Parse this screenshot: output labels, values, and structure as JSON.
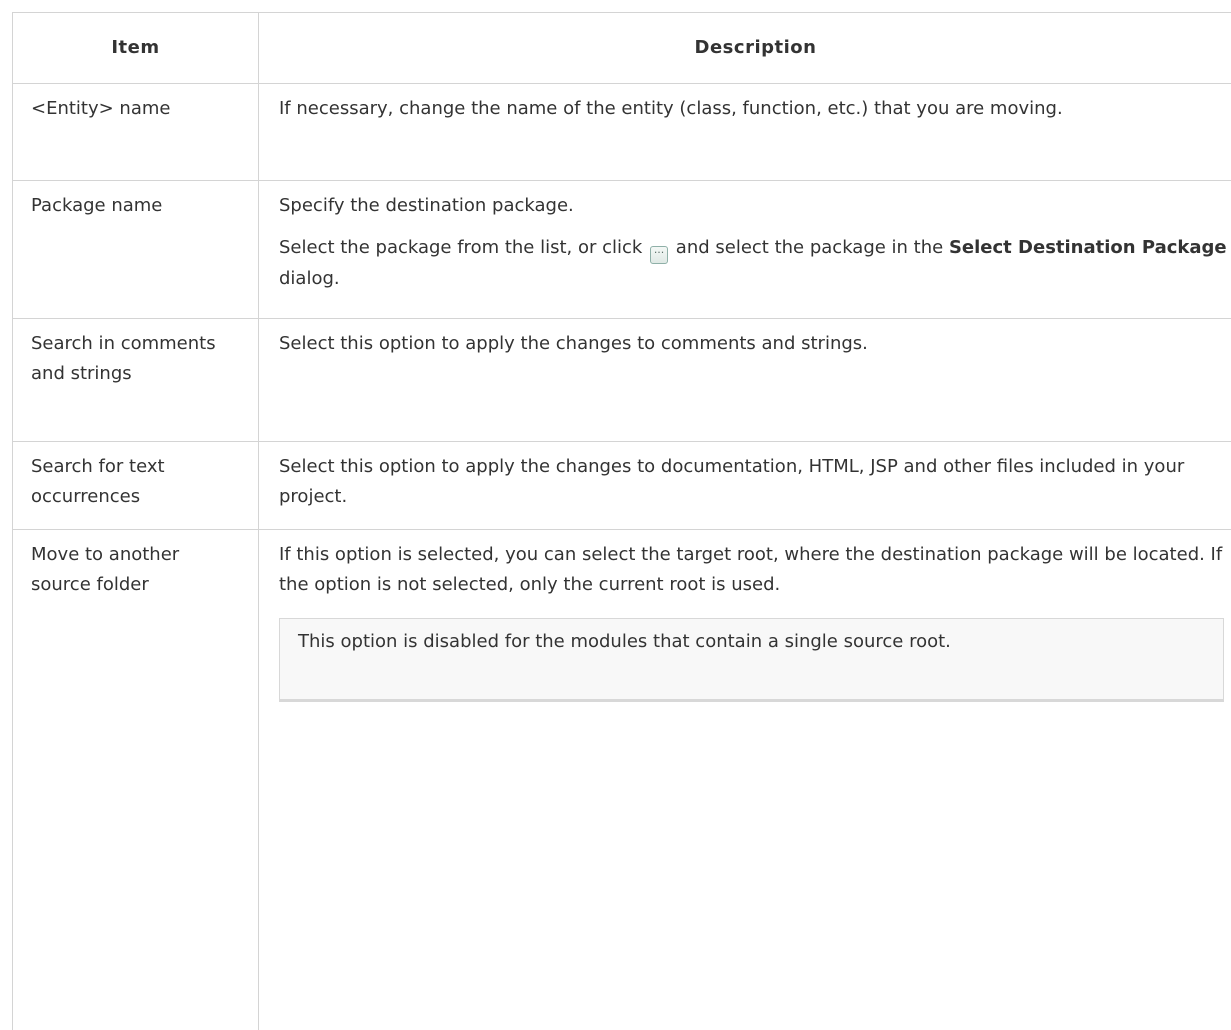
{
  "header": {
    "item": "Item",
    "description": "Description"
  },
  "rows": [
    {
      "item": "<Entity> name",
      "description": "If necessary, change the name of the entity (class, function, etc.) that you are moving."
    },
    {
      "item": "Package name",
      "description": "Specify the destination package.",
      "description2_before": "Select the package from the list, or click ",
      "browse_icon": "ellipsis-button-icon",
      "browse_glyph": "···",
      "description2_middle": " and select the package in the ",
      "dialog_name": "Select Destination Package",
      "description2_after": " dialog."
    },
    {
      "item": "Search in comments and strings",
      "description": "Select this option to apply the changes to comments and strings."
    },
    {
      "item": "Search for text occurrences",
      "description": "Select this option to apply the changes to documentation, HTML, JSP and other files included in your project."
    },
    {
      "item": "Move to another source folder",
      "description": "If this option is selected, you can select the target root, where the destination package will be located. If the option is not selected, only the current root is used.",
      "note": "This option is disabled for the modules that contain a single source root."
    }
  ]
}
